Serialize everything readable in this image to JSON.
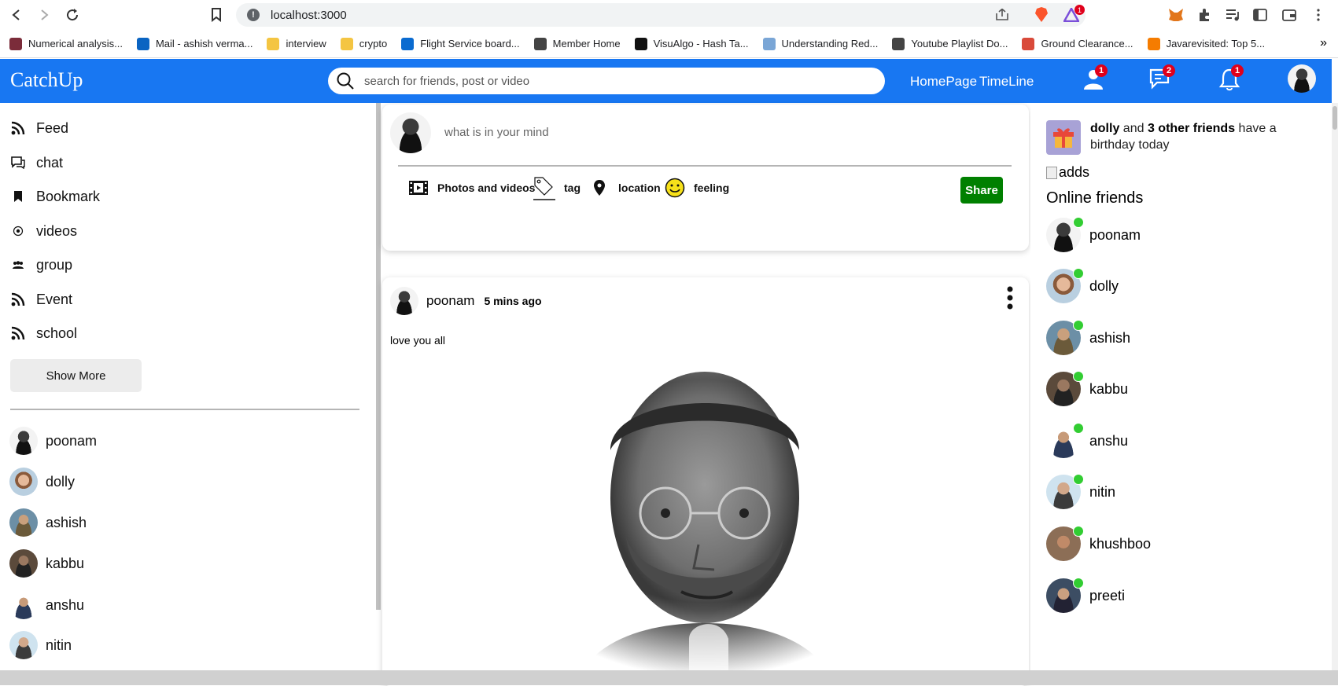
{
  "browser": {
    "url": "localhost:3000",
    "info_glyph": "!",
    "extension_badge": "1",
    "bookmarks": [
      {
        "label": "Numerical analysis...",
        "color": "#7b2c3a"
      },
      {
        "label": "Mail - ashish verma...",
        "color": "#0a64c2"
      },
      {
        "label": "interview",
        "color": "#f4c542"
      },
      {
        "label": "crypto",
        "color": "#f4c542"
      },
      {
        "label": "Flight Service board...",
        "color": "#0a6bd0"
      },
      {
        "label": "Member Home",
        "color": "#444444"
      },
      {
        "label": "VisuAlgo - Hash Ta...",
        "color": "#111111"
      },
      {
        "label": "Understanding Red...",
        "color": "#7aa6d6"
      },
      {
        "label": "Youtube Playlist Do...",
        "color": "#444444"
      },
      {
        "label": "Ground Clearance...",
        "color": "#d94a3a"
      },
      {
        "label": "Javarevisited: Top 5...",
        "color": "#f57c00"
      }
    ],
    "more": "»"
  },
  "topbar": {
    "logo": "CatchUp",
    "search_placeholder": "search for friends, post or video",
    "links": [
      "HomePage",
      "TimeLine"
    ],
    "badges": {
      "friends": "1",
      "messages": "2",
      "notifications": "1"
    },
    "color": "#1877f2"
  },
  "sidebar": {
    "items": [
      {
        "label": "Feed",
        "icon": "rss-icon"
      },
      {
        "label": "chat",
        "icon": "chat-icon"
      },
      {
        "label": "Bookmark",
        "icon": "bookmark-icon"
      },
      {
        "label": "videos",
        "icon": "play-circle-icon"
      },
      {
        "label": "group",
        "icon": "group-icon"
      },
      {
        "label": "Event",
        "icon": "rss-icon"
      },
      {
        "label": "school",
        "icon": "rss-icon"
      }
    ],
    "show_more": "Show More",
    "friends": [
      "poonam",
      "dolly",
      "ashish",
      "kabbu",
      "anshu",
      "nitin"
    ]
  },
  "share": {
    "placeholder": "what is in your mind",
    "options": [
      "Photos and videos",
      "tag",
      "location",
      "feeling"
    ],
    "button": "Share",
    "button_color": "#008000"
  },
  "post": {
    "user": "poonam",
    "time": "5 mins ago",
    "text": "love you all"
  },
  "rightbar": {
    "birthday": {
      "name": "dolly",
      "middle": "and",
      "others": "3 other friends",
      "suffix": "have a birthday today"
    },
    "ads_alt": "adds",
    "online_title": "Online friends",
    "online": [
      "poonam",
      "dolly",
      "ashish",
      "kabbu",
      "anshu",
      "nitin",
      "khushboo",
      "preeti"
    ],
    "online_color": "#32cd32"
  }
}
